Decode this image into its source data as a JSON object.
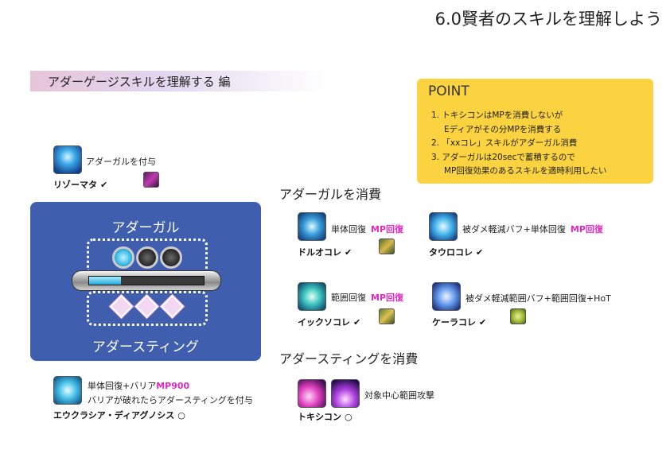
{
  "page_title": "6.0賢者のスキルを理解しよう",
  "section_banner": "アダーゲージスキルを理解する 編",
  "point": {
    "title": "POINT",
    "items": [
      "1. トキシコンはMPを消費しないが",
      "Eディアがその分MPを消費する",
      "2. 「xxコレ」スキルがアダーガル消費",
      "3. アダーガルは20secで蓄積するので",
      "MP回復効果のあるスキルを適時利用したい"
    ]
  },
  "rhizomata": {
    "name": "リゾーマタ",
    "mark": "✔",
    "desc": "アダーガルを付与"
  },
  "gauge": {
    "top_label": "アダーガル",
    "bottom_label": "アダースティング",
    "fill_fraction": 0.28,
    "colors": {
      "panel": "#3f5fae",
      "gem_on": "#37b8e6",
      "gem_off": "#2e2e2e"
    }
  },
  "diagnosis": {
    "desc1_text": "単体回復+バリア",
    "desc1_mp": "MP900",
    "desc2": "バリアが破れたらアダースティングを付与",
    "name": "エウクラシア・ディアグノシス",
    "mark": "○"
  },
  "addersgall_heading": "アダーガルを消費",
  "druochole": {
    "text": "単体回復",
    "mp": "MP回復",
    "name": "ドルオコレ",
    "mark": "✔"
  },
  "taurochole": {
    "text": "被ダメ軽減バフ+単体回復",
    "mp": "MP回復",
    "name": "タウロコレ",
    "mark": "✔"
  },
  "ixochole": {
    "text": "範囲回復",
    "mp": "MP回復",
    "name": "イックソコレ",
    "mark": "✔"
  },
  "kerachole": {
    "text": "被ダメ軽減範囲バフ+範囲回復+HoT",
    "name": "ケーラコレ",
    "mark": "✔"
  },
  "addersting_heading": "アダースティングを消費",
  "toxikon": {
    "text": "対象中心範囲攻撃",
    "name": "トキシコン",
    "mark": "○"
  },
  "colors": {
    "mp_accent": "#e02ac0",
    "point_bg": "#fbd240"
  }
}
